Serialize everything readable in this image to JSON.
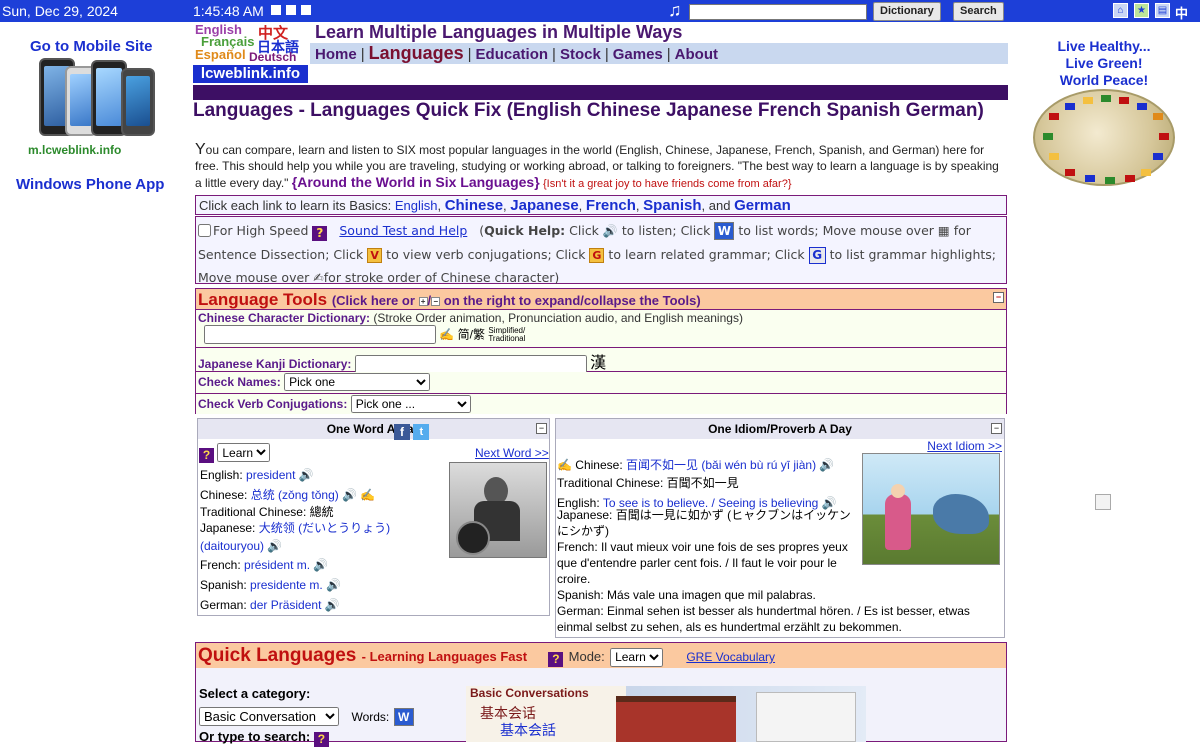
{
  "topbar": {
    "date": "Sun, Dec 29, 2024",
    "time": "1:45:48 AM",
    "dictionary_label": "Dictionary",
    "search_label": "Search",
    "chinese_label": "中文"
  },
  "left": {
    "mobile_title": "Go to Mobile Site",
    "mobile_url": "m.lcweblink.info",
    "windows_app": "Windows Phone App"
  },
  "right": {
    "live_line1": "Live Healthy...",
    "live_line2": "Live Green!",
    "live_line3": "World Peace!"
  },
  "logo": {
    "english": "English",
    "francais": "Français",
    "espanol": "Español",
    "zhongwen": "中文",
    "nihongo": "日本語",
    "deutsch": "Deutsch",
    "site": "lcweblink.info"
  },
  "header": {
    "title": "Learn Multiple Languages in Multiple Ways",
    "nav": [
      "Home",
      "Languages",
      "Education",
      "Stock",
      "Games",
      "About"
    ]
  },
  "page": {
    "title": "Languages - Languages Quick Fix (English Chinese Japanese French Spanish German)",
    "intro_first": "Y",
    "intro_text": "ou can compare, learn and listen to SIX most popular languages in the world (English, Chinese, Japanese, French, Spanish, and German) here for free. This should help you while you are traveling, studying or working abroad, or talking to foreigners. \"The best way to learn a language is by speaking a little every day.\"",
    "around": "{Around the World in Six Languages}",
    "quote": "{Isn't it a great joy to have friends come from afar?}"
  },
  "basics": {
    "prefix": "Click each link to learn its Basics:",
    "english": "English",
    "chinese": "Chinese",
    "japanese": "Japanese",
    "french": "French",
    "spanish": "Spanish",
    "and": ", and",
    "german": "German"
  },
  "help": {
    "high_speed": "For High Speed",
    "sound_test": "Sound Test and Help",
    "quick_help": "Quick Help:",
    "click": "Click",
    "to_listen": "to listen;",
    "to_list_words": "to list words; Move mouse over",
    "for": "for",
    "sentence_dissection": "Sentence Dissection; Click",
    "to_view_verb": "to view verb conjugations; Click",
    "to_learn_grammar": "to learn related grammar; Click",
    "to_list_grammar": "to list grammar highlights;",
    "move_mouse_over": "Move mouse over",
    "stroke_order": "for stroke order of Chinese character)"
  },
  "tools": {
    "title": "Language Tools",
    "subtitle_a": "(Click here or",
    "subtitle_b": "on the right to expand/collapse the Tools)",
    "chinese_dict_label": "Chinese Character Dictionary:",
    "chinese_dict_note": "(Stroke Order animation, Pronunciation audio, and English meanings)",
    "simp_trad": "简/繁",
    "simp_trad_small": "Simplified/ Traditional",
    "kanji_label": "Japanese Kanji Dictionary:",
    "kanji_char": "漢",
    "check_names_label": "Check Names:",
    "check_names_value": "Pick one",
    "check_verb_label": "Check Verb Conjugations:",
    "check_verb_value": "Pick one ..."
  },
  "word_of_day": {
    "title": "One Word A Day",
    "mode": "Learn",
    "next": "Next Word >>",
    "english_label": "English:",
    "english": "president",
    "chinese_label": "Chinese:",
    "chinese": "总统 (zǒng tǒng)",
    "trad_label": "Traditional Chinese:",
    "trad": "總統",
    "japanese_label": "Japanese:",
    "japanese": "大统领 (だいとうりょう)",
    "japanese_romaji": "(daitouryou)",
    "french_label": "French:",
    "french": "président m.",
    "spanish_label": "Spanish:",
    "spanish": "presidente m.",
    "german_label": "German:",
    "german": "der Präsident"
  },
  "idiom_of_day": {
    "title": "One Idiom/Proverb A Day",
    "next": "Next Idiom >>",
    "chinese_label": "Chinese:",
    "chinese": "百闻不如一见 (bǎi wén bù rú yī jiàn)",
    "trad_label": "Traditional Chinese:",
    "trad": "百聞不如一見",
    "english_label": "English:",
    "english": "To see is to believe. / Seeing is believing",
    "japanese_label": "Japanese:",
    "japanese": "百聞は一見に如かず (ヒャクブンはイッケンにシかず)",
    "french_label": "French:",
    "french": "Il vaut mieux voir une fois de ses propres yeux que d'entendre parler cent fois. / Il faut le voir pour le croire.",
    "spanish_label": "Spanish:",
    "spanish": "Más vale una imagen que mil palabras.",
    "german_label": "German:",
    "german": "Einmal sehen ist besser als hundertmal hören. / Es ist besser, etwas einmal selbst zu sehen, als es hundertmal erzählt zu bekommen."
  },
  "quick": {
    "title": "Quick Languages",
    "subtitle": "- Learning Languages Fast",
    "mode_label": "Mode:",
    "mode": "Learn",
    "gre": "GRE Vocabulary",
    "select_category": "Select a category:",
    "category": "Basic Conversation",
    "words_label": "Words:",
    "type_to_search": "Or type to search:",
    "banner_title": "Basic Conversations",
    "banner_zh1": "基本会话",
    "banner_zh2": "基本会話"
  }
}
